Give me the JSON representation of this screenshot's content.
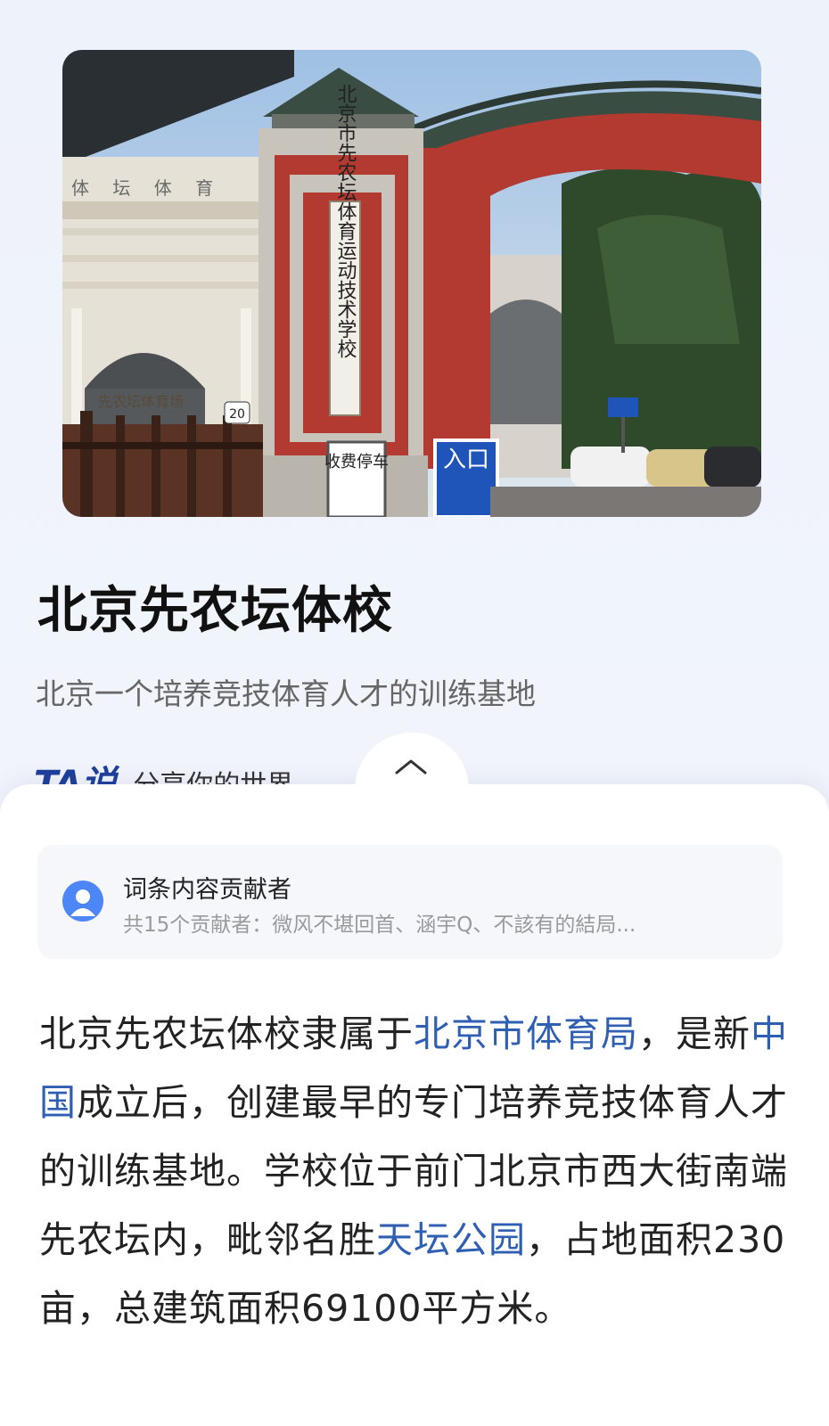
{
  "hero": {
    "gate_sign": "北京市先农坛体育运动技术学校",
    "stadium_sign": "先农坛体育场",
    "entrance_sign": "入口",
    "parking_sign": "收费停车",
    "number_badge": "20"
  },
  "page_title": "北京先农坛体校",
  "subtitle": "北京一个培养竞技体育人才的训练基地",
  "brand": {
    "logo": "TA说",
    "slogan": "分享你的世界"
  },
  "contributors": {
    "title": "词条内容贡献者",
    "summary": "共15个贡献者：微风不堪回首、涵宇Q、不該有的結局..."
  },
  "article": {
    "p1": "北京先农坛体校隶属于",
    "link1": "北京市体育局",
    "p2": "，是新",
    "link2": "中国",
    "p3": "成立后，创建最早的专门培养竞技体育人才的训练基地。学校位于前门北京市西大街南端先农坛内，毗邻名胜",
    "link3": "天坛公园",
    "p4": "，占地面积230亩，总建筑面积69100平方米。"
  },
  "colors": {
    "link": "#2f5fb3",
    "gate_red": "#b23a30",
    "avatar": "#4d86f7"
  },
  "icons": [
    "chevron-up-icon",
    "user-avatar-icon"
  ]
}
